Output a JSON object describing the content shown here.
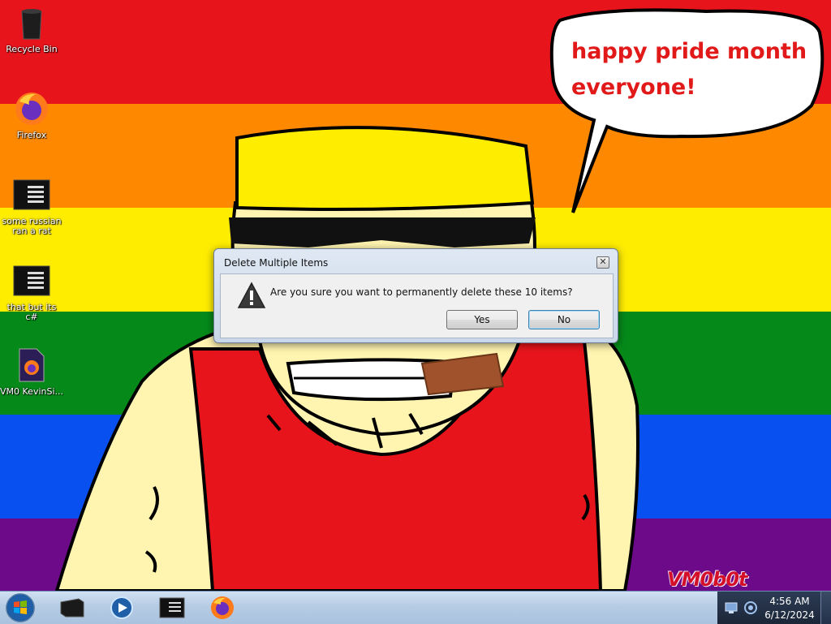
{
  "desktop": {
    "icons": [
      {
        "name": "recycle-bin-icon",
        "label": "Recycle Bin"
      },
      {
        "name": "firefox-icon",
        "label": "Firefox"
      },
      {
        "name": "terminal-file-icon",
        "label": "some russian ran a rat"
      },
      {
        "name": "terminal-file-icon",
        "label": "that but its c#"
      },
      {
        "name": "firefox-file-icon",
        "label": "VM0 KevinSi..."
      }
    ],
    "speech_text": "happy pride month everyone!",
    "signature": "VM0b0t",
    "colors": {
      "red": "#e8141c",
      "orange": "#fe8800",
      "yellow": "#ffed00",
      "green": "#058a1a",
      "blue": "#0850f0",
      "purple": "#6c0a8a"
    }
  },
  "dialog": {
    "title": "Delete Multiple Items",
    "message": "Are you sure you want to permanently delete these 10 items?",
    "yes_label": "Yes",
    "no_label": "No",
    "close_glyph": "✕"
  },
  "taskbar": {
    "pinned": [
      "terminal-icon",
      "media-player-icon",
      "console-window-icon",
      "firefox-icon"
    ],
    "clock_time": "4:56 AM",
    "clock_date": "6/12/2024"
  }
}
